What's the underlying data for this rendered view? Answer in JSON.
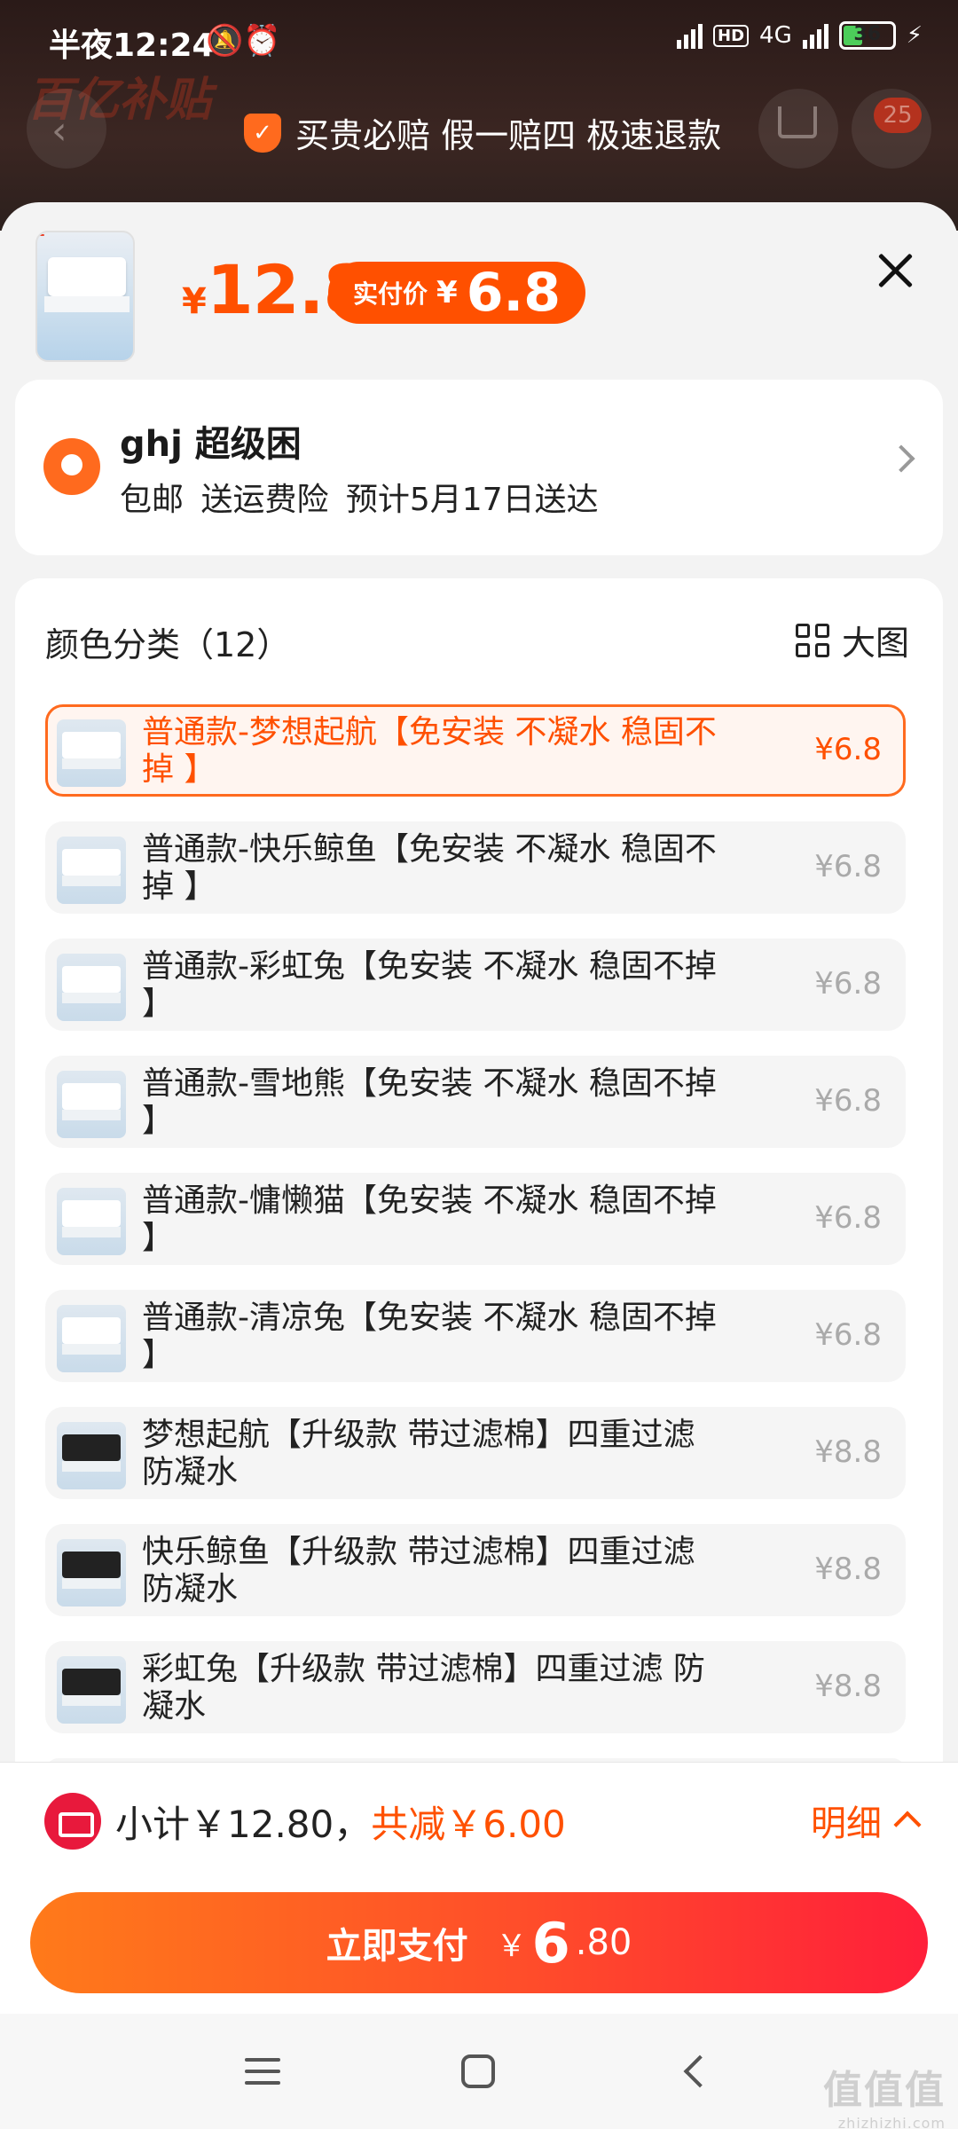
{
  "status": {
    "time": "半夜12:24",
    "left_icons": "🔕⏰",
    "hd": "HD",
    "network": "4G",
    "battery": "36"
  },
  "page_header": {
    "banner": "百亿补贴",
    "badge": "25",
    "guarantee": "买贵必赔 假一赔四 极速退款",
    "shield_glyph": "✓"
  },
  "product": {
    "price_symbol": "¥",
    "price": "12.8",
    "paid_label": "实付价",
    "paid_symbol": "¥",
    "paid_price": "6.8"
  },
  "address": {
    "name": "ghj 超级困",
    "shipping": "包邮  送运费险  预计5月17日送达"
  },
  "options": {
    "heading": "颜色分类（12）",
    "big_view": "大图",
    "items": [
      {
        "title": "普通款-梦想起航【免安装 不凝水 稳固不掉 】",
        "price": "¥6.8"
      },
      {
        "title": "普通款-快乐鲸鱼【免安装 不凝水 稳固不掉 】",
        "price": "¥6.8"
      },
      {
        "title": "普通款-彩虹兔【免安装 不凝水 稳固不掉 】",
        "price": "¥6.8"
      },
      {
        "title": "普通款-雪地熊【免安装 不凝水 稳固不掉 】",
        "price": "¥6.8"
      },
      {
        "title": "普通款-慵懒猫【免安装 不凝水 稳固不掉 】",
        "price": "¥6.8"
      },
      {
        "title": "普通款-清凉兔【免安装 不凝水 稳固不掉 】",
        "price": "¥6.8"
      },
      {
        "title": "梦想起航【升级款 带过滤棉】四重过滤 防凝水",
        "price": "¥8.8"
      },
      {
        "title": "快乐鲸鱼【升级款 带过滤棉】四重过滤 防凝水",
        "price": "¥8.8"
      },
      {
        "title": "彩虹兔【升级款 带过滤棉】四重过滤 防凝水",
        "price": "¥8.8"
      }
    ]
  },
  "footer": {
    "subtotal": "小计￥12.80，",
    "discount": "共减￥6.00",
    "detail": "明细",
    "pay_label": "立即支付",
    "pay_symbol": "￥",
    "pay_int": "6",
    "pay_dec": ".80"
  },
  "watermark": {
    "main": "值值值",
    "sub": "zhizhizhi.com"
  }
}
